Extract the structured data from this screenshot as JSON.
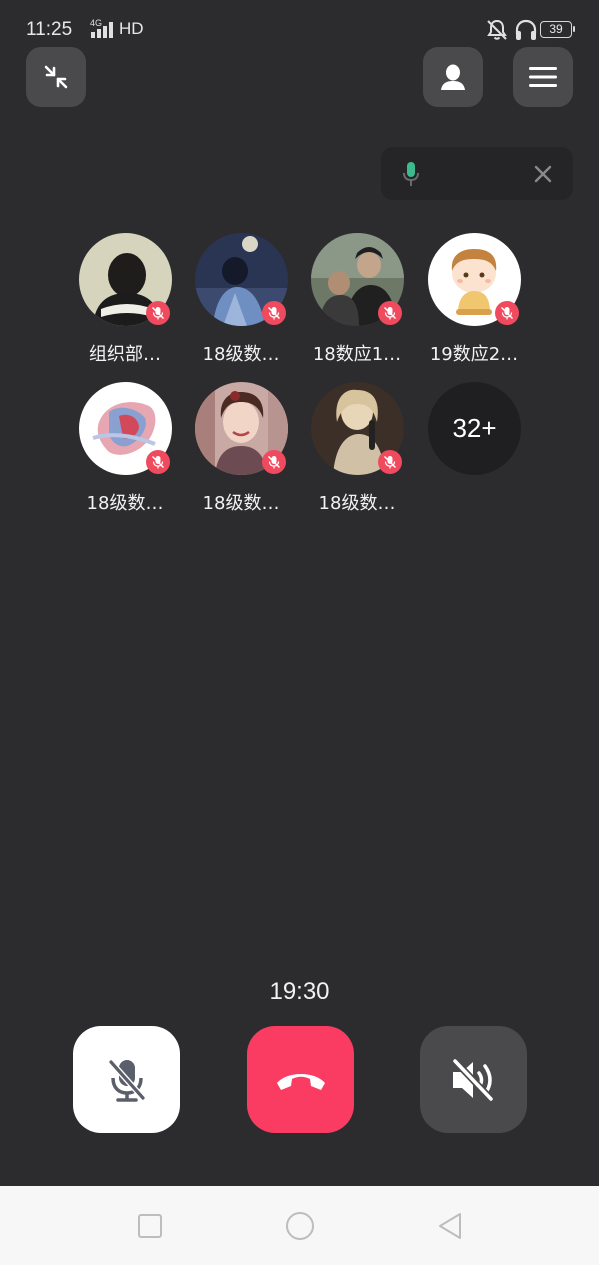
{
  "status_bar": {
    "time": "11:25",
    "network_sub": "4G",
    "network_label": "HD",
    "battery": "39"
  },
  "participants": [
    {
      "name": "组织部…",
      "muted": true,
      "avatar": "avatar-girl-back-icon"
    },
    {
      "name": "18级数…",
      "muted": true,
      "avatar": "avatar-moon-night-icon"
    },
    {
      "name": "18数应1…",
      "muted": true,
      "avatar": "avatar-couple-photo-icon"
    },
    {
      "name": "19数应2…",
      "muted": true,
      "avatar": "avatar-cartoon-boy-icon"
    },
    {
      "name": "18级数…",
      "muted": true,
      "avatar": "avatar-heart-art-icon"
    },
    {
      "name": "18级数…",
      "muted": true,
      "avatar": "avatar-girl-smile-icon"
    },
    {
      "name": "18级数…",
      "muted": true,
      "avatar": "avatar-singer-icon"
    }
  ],
  "more_count": "32+",
  "call_timer": "19:30",
  "colors": {
    "background": "#2c2c2e",
    "mute_badge": "#f04a5f",
    "hangup": "#fa3c63",
    "panel": "#4a4a4c"
  }
}
